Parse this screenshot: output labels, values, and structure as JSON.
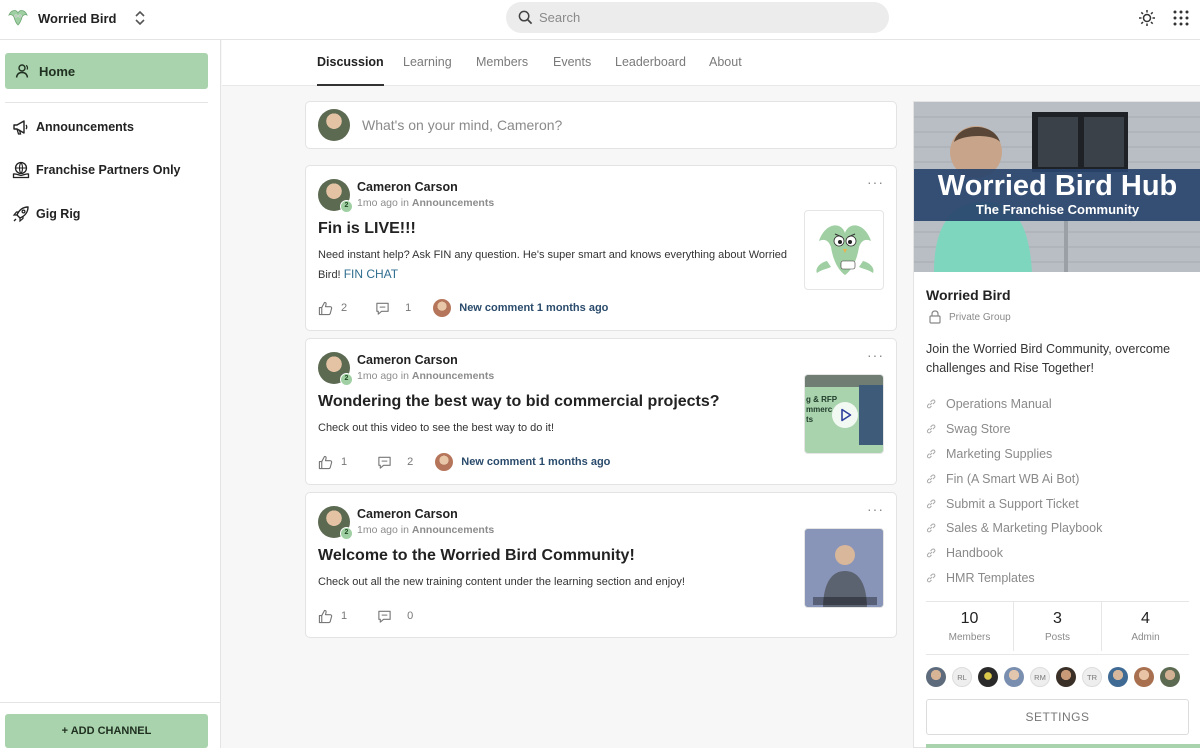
{
  "app": {
    "name": "Worried Bird"
  },
  "search": {
    "placeholder": "Search"
  },
  "sidebar": {
    "home": "Home",
    "items": [
      {
        "label": "Announcements",
        "icon": "megaphone-icon"
      },
      {
        "label": "Franchise Partners Only",
        "icon": "globe-hand-icon"
      },
      {
        "label": "Gig Rig",
        "icon": "rocket-icon"
      }
    ],
    "add_channel": "+ ADD CHANNEL"
  },
  "tabs": [
    "Discussion",
    "Learning",
    "Members",
    "Events",
    "Leaderboard",
    "About"
  ],
  "active_tab": "Discussion",
  "composer": {
    "placeholder": "What's on your mind, Cameron?"
  },
  "posts": [
    {
      "author": "Cameron Carson",
      "level": "2",
      "time": "1mo ago",
      "in": "in",
      "category": "Announcements",
      "title": "Fin is LIVE!!!",
      "body": "Need instant help? Ask FIN any question. He's super smart and knows everything about Worried Bird!",
      "link": "FIN CHAT",
      "likes": "2",
      "comments": "1",
      "new_comment": "New comment 1 months ago"
    },
    {
      "author": "Cameron Carson",
      "level": "2",
      "time": "1mo ago",
      "in": "in",
      "category": "Announcements",
      "title": "Wondering the best way to bid commercial projects?",
      "body": "Check out this video to see the best way to do it!",
      "thumb_text": "g & RFP\nmmerc\nts",
      "likes": "1",
      "comments": "2",
      "new_comment": "New comment 1 months ago"
    },
    {
      "author": "Cameron Carson",
      "level": "2",
      "time": "1mo ago",
      "in": "in",
      "category": "Announcements",
      "title": "Welcome to the Worried Bird Community!",
      "body": "Check out all the new training content under the learning section and enjoy!",
      "likes": "1",
      "comments": "0"
    }
  ],
  "group": {
    "cover_title": "Worried Bird Hub",
    "cover_subtitle": "The Franchise Community",
    "name": "Worried Bird",
    "type": "Private Group",
    "description": "Join the Worried Bird Community, overcome challenges and Rise Together!",
    "links": [
      "Operations Manual",
      "Swag Store",
      "Marketing Supplies",
      "Fin (A Smart WB Ai Bot)",
      "Submit a Support Ticket",
      "Sales & Marketing Playbook",
      "Handbook",
      "HMR Templates"
    ],
    "stats": [
      {
        "num": "10",
        "label": "Members"
      },
      {
        "num": "3",
        "label": "Posts"
      },
      {
        "num": "4",
        "label": "Admin"
      }
    ],
    "member_initials": [
      "RL",
      "RM",
      "TR"
    ],
    "settings": "SETTINGS"
  },
  "colors": {
    "accent_green": "#a9d3ac",
    "link_blue": "#2f6e8f",
    "cover_band": "#28446c"
  }
}
